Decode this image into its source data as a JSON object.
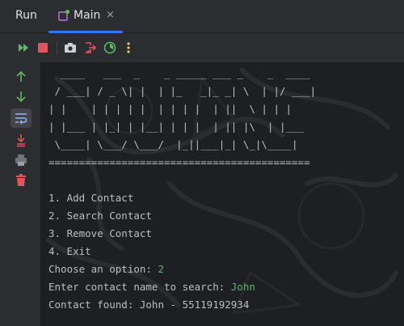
{
  "tabs": {
    "run_label": "Run",
    "main_title": "Main",
    "close_glyph": "×"
  },
  "toolbar": {
    "icons": [
      "rerun-icon",
      "stop-icon",
      "screenshot-icon",
      "exit-icon",
      "coverage-icon",
      "more-icon"
    ]
  },
  "gutter": {
    "icons": [
      "scroll-up-icon",
      "scroll-down-icon",
      "soft-wrap-icon",
      "scroll-to-end-icon",
      "print-icon",
      "clear-icon"
    ]
  },
  "console": {
    "ascii_lines": [
      "  ____   ___  _    _ _____ ___ _    _  ____",
      " / ___| / _ \\| |  | |_   _|_ _| \\  | |/ ___|",
      "| |    | | | | |  | | | |  | ||  \\ | | |",
      "| |___ | |_| | |__| | | |  | || |\\  | |___",
      " \\____| \\___/ \\___/  |_||___|_| \\_|\\____|"
    ],
    "separator": "===========================================",
    "menu": [
      "1. Add Contact",
      "2. Search Contact",
      "3. Remove Contact",
      "4. Exit"
    ],
    "prompt_option": "Choose an option: ",
    "option_input": "2",
    "prompt_name": "Enter contact name to search: ",
    "name_input": "John",
    "result": "Contact found: John - 55119192934"
  },
  "colors": {
    "accent": "#3574f0",
    "run_green": "#5fb865",
    "stop_red": "#e0555d",
    "user_input": "#6aab73",
    "more_yellow": "#f2c55c"
  }
}
